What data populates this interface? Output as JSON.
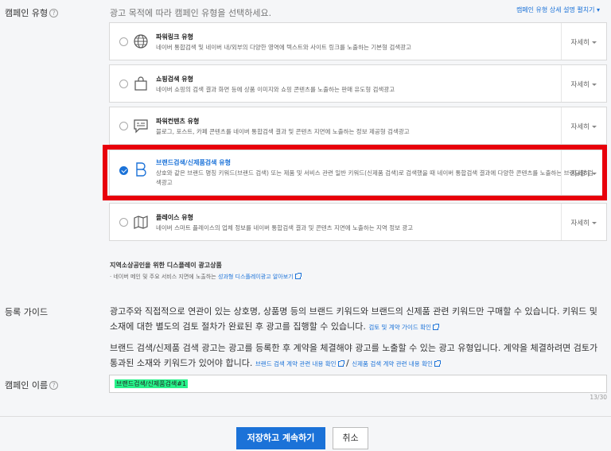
{
  "campaign_type": {
    "label": "캠페인 유형",
    "hint": "광고 목적에 따라 캠페인 유형을 선택하세요.",
    "detail_link": "캠페인 유형 상세 설명 펼치기",
    "more_label": "자세히",
    "options": [
      {
        "title": "파워링크 유형",
        "desc": "네이버 통합검색 및 네이버 내/외부의 다양한 영역에 텍스트와 사이트 링크를 노출하는 기본형 검색광고",
        "selected": false,
        "icon": "globe-icon"
      },
      {
        "title": "쇼핑검색 유형",
        "desc": "네이버 쇼핑의 검색 결과 화면 등에 상품 이미지와 쇼핑 콘텐츠를 노출하는 판매 유도형 검색광고",
        "selected": false,
        "icon": "shopping-bag-icon"
      },
      {
        "title": "파워컨텐츠 유형",
        "desc": "블로그, 포스트, 카페 콘텐츠를 네이버 통합검색 결과 및 콘텐츠 지면에 노출하는 정보 제공형 검색광고",
        "selected": false,
        "icon": "content-bubble-icon"
      },
      {
        "title": "브랜드검색/신제품검색 유형",
        "desc": "상호와 같은 브랜드 명칭 키워드(브랜드 검색) 또는 제품 및 서비스 관련 일반 키워드(신제품 검색)로 검색했을 때 네이버 통합검색 결과에 다양한 콘텐츠를 노출하는 브랜딩형 검색광고",
        "selected": true,
        "icon": "brand-b-icon"
      },
      {
        "title": "플레이스 유형",
        "desc": "네이버 스마트 플레이스의 업체 정보를 네이버 통합검색 결과 및 콘텐츠 지면에 노출하는 지역 정보 광고",
        "selected": false,
        "icon": "map-icon"
      }
    ],
    "local": {
      "title": "지역소상공인을 위한 디스플레이 광고상품",
      "desc": "· 네이버 메인 및 주요 서비스 지면에 노출하는",
      "link": "성과형 디스플레이광고 알아보기"
    }
  },
  "guide": {
    "label": "등록 가이드",
    "p1": "광고주와 직접적으로 연관이 있는 상호명, 상품명 등의 브랜드 키워드와 브랜드의 신제품 관련 키워드만 구매할 수 있습니다. 키워드 및 소재에 대한 별도의 검토 절차가 완료된 후 광고를 집행할 수 있습니다.",
    "p1_link": "검토 및 계약 가이드 확인",
    "p2": "브랜드 검색/신제품 검색 광고는 광고를 등록한 후 계약을 체결해야 광고를 노출할 수 있는 광고 유형입니다. 계약을 체결하려면 검토가 통과된 소재와 키워드가 있어야 합니다.",
    "p2_link1": "브랜드 검색 계약 관련 내용 확인",
    "sep": "/",
    "p2_link2": "신제품 검색 계약 관련 내용 확인"
  },
  "name": {
    "label": "캠페인 이름",
    "value": "브랜드검색/신제품검색#1",
    "counter": "13/30"
  },
  "buttons": {
    "save": "저장하고 계속하기",
    "cancel": "취소"
  },
  "colors": {
    "accent": "#1b72d8",
    "highlight": "#e8000b",
    "name_highlight": "#27f28a"
  }
}
